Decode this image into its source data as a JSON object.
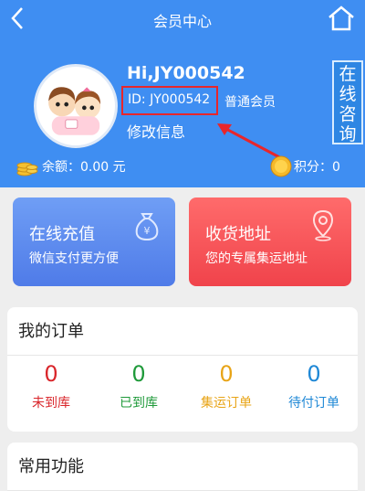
{
  "nav": {
    "title": "会员中心",
    "back_icon": "chevron-left-icon",
    "home_icon": "home-icon"
  },
  "profile": {
    "greeting": "Hi,JY000542",
    "id_text": "ID: JY000542",
    "level": "普通会员",
    "edit_label": "修改信息",
    "avatar_icon": "cartoon-couple-avatar"
  },
  "online_service": {
    "label": "在线咨询"
  },
  "wallet": {
    "balance_text": "余额：0.00 元",
    "points_text": "积分：0",
    "balance_icon": "coin-stack-icon",
    "points_icon": "gold-coin-icon"
  },
  "cards": {
    "recharge": {
      "title": "在线充值",
      "subtitle": "微信支付更方便",
      "icon": "money-bag-icon"
    },
    "address": {
      "title": "收货地址",
      "subtitle": "您的专属集运地址",
      "icon": "location-pin-icon"
    }
  },
  "orders": {
    "title": "我的订单",
    "items": [
      {
        "count": "0",
        "label": "未到库",
        "color": "#d9262b"
      },
      {
        "count": "0",
        "label": "已到库",
        "color": "#1f9a3a"
      },
      {
        "count": "0",
        "label": "集运订单",
        "color": "#e8a417"
      },
      {
        "count": "0",
        "label": "待付订单",
        "color": "#1f88d6"
      }
    ]
  },
  "tools": {
    "title": "常用功能"
  },
  "colors": {
    "header_bg": "#3f8ef2",
    "highlight": "#e8262b"
  }
}
